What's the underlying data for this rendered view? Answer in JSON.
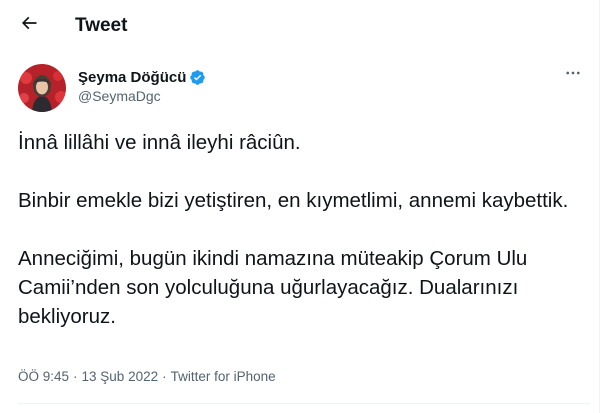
{
  "header": {
    "title": "Tweet",
    "back_icon": "arrow-left-icon"
  },
  "author": {
    "display_name": "Şeyma Döğücü",
    "handle": "@SeymaDgc",
    "verified_icon": "verified-badge-icon",
    "verified_color": "#1d9bf0",
    "more_icon": "more-horizontal-icon"
  },
  "tweet": {
    "paragraphs": [
      "İnnâ lillâhi ve innâ ileyhi râciûn.",
      "Binbir emekle bizi yetiştiren, en kıymetlimi, annemi kaybettik.",
      "Anneciğimi, bugün ikindi namazına müteakip Çorum Ulu Camii’nden son yolculuğuna uğurlayacağız. Dualarınızı bekliyoruz."
    ],
    "time": "ÖÖ 9:45",
    "date": "13 Şub 2022",
    "source": "Twitter for iPhone",
    "separator": "·"
  }
}
